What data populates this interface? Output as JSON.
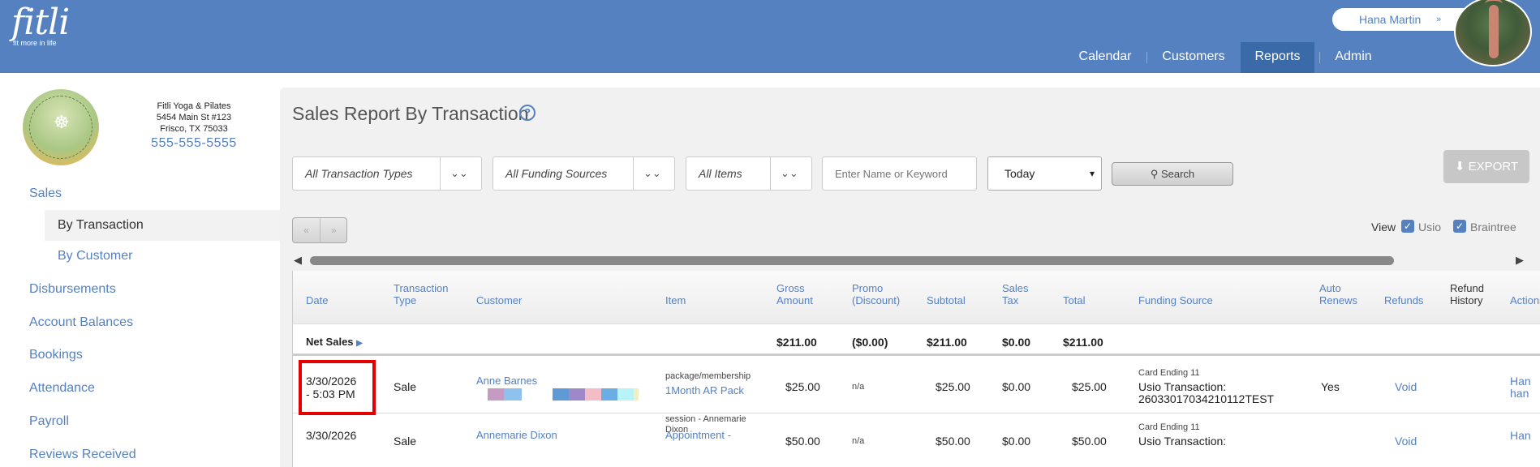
{
  "header": {
    "logo_word": "fitli",
    "logo_tagline": "fit more in life",
    "user_name": "Hana Martin",
    "user_chevron": "»",
    "nav": [
      {
        "label": "Calendar"
      },
      {
        "label": "Customers"
      },
      {
        "label": "Reports",
        "active": true
      },
      {
        "label": "Admin"
      }
    ]
  },
  "club": {
    "name": "Fitli Yoga & Pilates",
    "address1": "5454 Main St #123",
    "address2": "Frisco, TX 75033",
    "phone": "555-555-5555",
    "logo_text": "FITLI YOGA & PILATES"
  },
  "sidebar": {
    "items": [
      {
        "label": "Sales"
      },
      {
        "label": "By Transaction",
        "sub": true,
        "active": true
      },
      {
        "label": "By Customer",
        "sub": true
      },
      {
        "label": "Disbursements"
      },
      {
        "label": "Account Balances"
      },
      {
        "label": "Bookings"
      },
      {
        "label": "Attendance"
      },
      {
        "label": "Payroll"
      },
      {
        "label": "Reviews Received"
      }
    ]
  },
  "page": {
    "title": "Sales Report By Transaction",
    "help_glyph": "?"
  },
  "filters": {
    "transaction_types": "All Transaction Types",
    "funding_sources": "All Funding Sources",
    "items": "All Items",
    "keyword_placeholder": "Enter Name or Keyword",
    "date_range": "Today",
    "search_label": "Search",
    "export_label": "EXPORT"
  },
  "pager": {
    "prev": "«",
    "next": "»"
  },
  "view": {
    "label": "View",
    "options": [
      {
        "label": "Usio",
        "checked": true
      },
      {
        "label": "Braintree",
        "checked": true
      }
    ]
  },
  "table": {
    "headers": {
      "date": "Date",
      "transaction_type": "Transaction Type",
      "customer": "Customer",
      "item": "Item",
      "gross_amount": "Gross Amount",
      "promo": "Promo (Discount)",
      "subtotal": "Subtotal",
      "sales_tax": "Sales Tax",
      "total": "Total",
      "funding_source": "Funding Source",
      "auto_renews": "Auto Renews",
      "refunds": "Refunds",
      "refund_history": "Refund History",
      "actions": "Actions"
    },
    "net_sales": {
      "label": "Net Sales",
      "gross": "$211.00",
      "promo": "($0.00)",
      "subtotal": "$211.00",
      "tax": "$0.00",
      "total": "$211.00"
    },
    "rows": [
      {
        "date": "3/30/2026",
        "time": "- 5:03 PM",
        "type": "Sale",
        "customer": "Anne Barnes",
        "item_category": "package/membership",
        "item_name": "1Month AR Pack",
        "gross": "$25.00",
        "promo": "n/a",
        "subtotal": "$25.00",
        "tax": "$0.00",
        "total": "$25.00",
        "funding_card": "Card Ending 11",
        "funding_txn_label": "Usio Transaction:",
        "funding_txn_id": "26033017034210112TEST",
        "auto_renews": "Yes",
        "refund_action": "Void",
        "actions_partial_1": "Han",
        "actions_partial_2": "han"
      },
      {
        "date": "3/30/2026",
        "type": "Sale",
        "customer": "Annemarie Dixon",
        "item_category": "session - Annemarie Dixon",
        "item_name": "Appointment -",
        "gross": "$50.00",
        "promo": "n/a",
        "subtotal": "$50.00",
        "tax": "$0.00",
        "total": "$50.00",
        "funding_card": "Card Ending 11",
        "funding_txn_label": "Usio Transaction:",
        "refund_action": "Void",
        "actions_partial_1": "Han"
      }
    ]
  },
  "colors": {
    "header_bg": "#5581c1",
    "nav_active_bg": "#3b6aa8",
    "link": "#5581c1",
    "highlight_box": "#e20000"
  }
}
